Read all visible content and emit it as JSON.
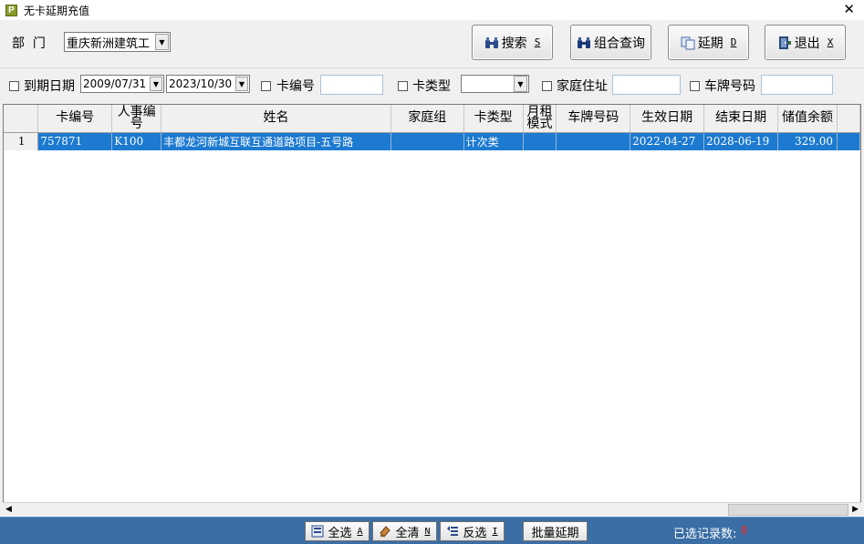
{
  "window": {
    "title": "无卡延期充值",
    "icon_letter": "P",
    "close_glyph": "✕"
  },
  "toolbar": {
    "dept_label": "部  门",
    "dept_value": "重庆新洲建筑工",
    "search_label": "搜索",
    "search_hotkey": "S",
    "combo_query_label": "组合查询",
    "extend_label": "延期",
    "extend_hotkey": "D",
    "exit_label": "退出",
    "exit_hotkey": "X"
  },
  "filters": {
    "expire_label": "到期日期",
    "date_from": "2009/07/31",
    "date_to": "2023/10/30",
    "card_no_label": "卡编号",
    "card_type_label": "卡类型",
    "address_label": "家庭住址",
    "plate_label": "车牌号码"
  },
  "table": {
    "headers": [
      "卡编号",
      "人事编号",
      "姓名",
      "家庭组",
      "卡类型",
      "月租模式",
      "车牌号码",
      "生效日期",
      "结束日期",
      "储值余额"
    ],
    "rows": [
      {
        "row_no": "1",
        "card_no": "757871",
        "staff_no": "K100",
        "name": "丰都龙河新城互联互通道路项目-五号路",
        "family_group": "",
        "card_type": "计次类",
        "monthly_mode": "",
        "plate": "",
        "start_date": "2022-04-27",
        "end_date": "2028-06-19",
        "balance": "329.00"
      }
    ]
  },
  "statusbar": {
    "select_all_label": "全选",
    "select_all_hotkey": "A",
    "clear_all_label": "全清",
    "clear_all_hotkey": "N",
    "invert_label": "反选",
    "invert_hotkey": "I",
    "batch_extend_label": "批量延期",
    "selected_count_label": "已选记录数:",
    "selected_count": "0"
  },
  "colors": {
    "selection": "#1c7ad0",
    "statusbar": "#3a6ea5",
    "count": "#ff2020"
  }
}
